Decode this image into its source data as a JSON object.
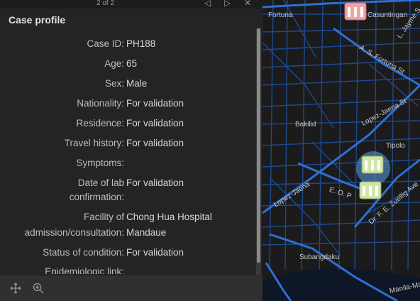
{
  "popup": {
    "pager_text": "2 of 2",
    "title": "Case profile",
    "fields": [
      {
        "label": "Case ID:",
        "value": "PH188"
      },
      {
        "label": "Age:",
        "value": "65"
      },
      {
        "label": "Sex:",
        "value": "Male"
      },
      {
        "label": "Nationality:",
        "value": "For validation"
      },
      {
        "label": "Residence:",
        "value": "For validation"
      },
      {
        "label": "Travel history:",
        "value": "For validation"
      },
      {
        "label": "Symptoms:",
        "value": ""
      },
      {
        "label_lines": [
          "Date of lab",
          "confirmation:"
        ],
        "value": "For validation"
      },
      {
        "label_lines": [
          "Facility of",
          "admission/consultation:"
        ],
        "value_lines": [
          "Chong Hua Hospital",
          "Mandaue"
        ]
      },
      {
        "label": "Status of condition:",
        "value": "For validation"
      },
      {
        "label": "Epidemiologic link:",
        "value": ""
      }
    ]
  },
  "icons": {
    "prev": "chevron-left-icon",
    "next": "chevron-right-icon",
    "close": "close-icon",
    "pan": "pan-move-icon",
    "zoom": "zoom-in-icon",
    "facility": "hospital-marker-icon"
  },
  "map": {
    "labels": [
      {
        "id": "fortuna",
        "text": "Fortuna"
      },
      {
        "id": "casuntingan",
        "text": "Casuntingan"
      },
      {
        "id": "jayme",
        "text": "L. Jayme S"
      },
      {
        "id": "asfortuna",
        "text": "A. S. Fortuna St"
      },
      {
        "id": "lopezjaena1",
        "text": "Lopez-Jaena St"
      },
      {
        "id": "bakilid",
        "text": "Bakilid"
      },
      {
        "id": "tipolo",
        "text": "Tipolo"
      },
      {
        "id": "lopezjaena2",
        "text": "Lopez-Jaena"
      },
      {
        "id": "eo",
        "text": "E. O. P"
      },
      {
        "id": "zuellig",
        "text": "Dr. F. E. Zuellig Ave"
      },
      {
        "id": "subangdaku",
        "text": "Subangdaku"
      },
      {
        "id": "manila",
        "text": "Manila-Ma"
      }
    ]
  },
  "colors": {
    "panel": "#242424",
    "road": "#2e6fd6",
    "water": "#0e1726",
    "marker_pink": "#f0a3a3",
    "marker_green": "#cfe6a8"
  }
}
